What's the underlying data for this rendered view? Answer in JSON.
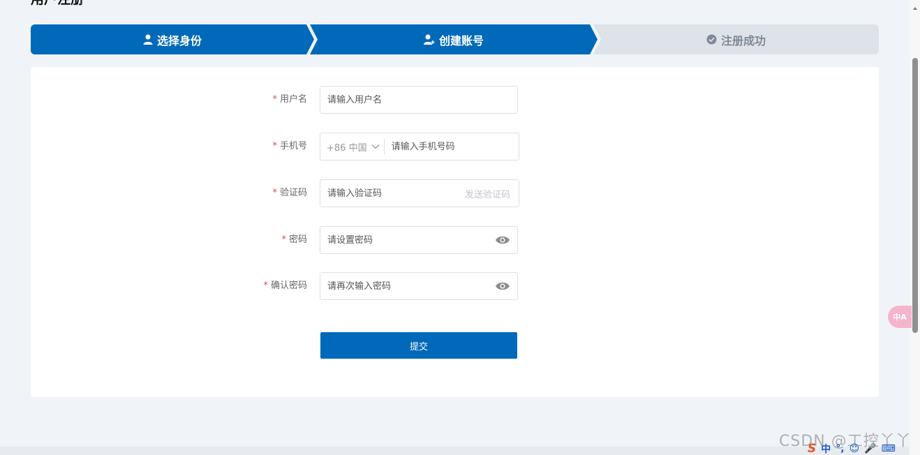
{
  "page": {
    "title": "用户注册"
  },
  "steps": [
    {
      "label": "选择身份",
      "icon": "user-icon",
      "state": "done"
    },
    {
      "label": "创建账号",
      "icon": "user-add-icon",
      "state": "active"
    },
    {
      "label": "注册成功",
      "icon": "check-circle-icon",
      "state": "pending"
    }
  ],
  "form": {
    "username": {
      "label": "用户名",
      "required": "*",
      "placeholder": "请输入用户名"
    },
    "phone": {
      "label": "手机号",
      "required": "*",
      "country": "+86 中国",
      "placeholder": "请输入手机号码"
    },
    "code": {
      "label": "验证码",
      "required": "*",
      "placeholder": "请输入验证码",
      "send_label": "发送验证码"
    },
    "password": {
      "label": "密码",
      "required": "*",
      "placeholder": "请设置密码"
    },
    "confirm": {
      "label": "确认密码",
      "required": "*",
      "placeholder": "请再次输入密码"
    },
    "submit_label": "提交"
  },
  "widgets": {
    "translate_label": "中A",
    "watermark": "CSDN @工控丫丫",
    "ime": {
      "logo": "S",
      "lang": "中",
      "punct": "°,",
      "emoji": "☺",
      "mic": "🎤",
      "keyboard": "⌨"
    }
  },
  "colors": {
    "primary": "#0069b9",
    "pending_step": "#dde3e9",
    "required": "#e24a4a"
  }
}
